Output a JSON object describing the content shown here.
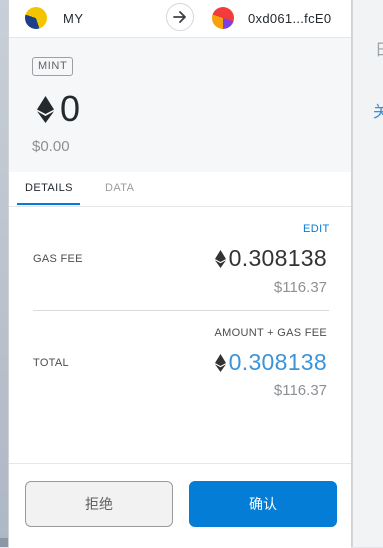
{
  "header": {
    "from_account_name": "MY",
    "to_account_address": "0xd061...fcE0"
  },
  "summary": {
    "action_badge": "MINT",
    "amount": "0",
    "fiat_amount": "$0.00"
  },
  "tabs": [
    {
      "label": "DETAILS",
      "active": true
    },
    {
      "label": "DATA",
      "active": false
    }
  ],
  "details": {
    "edit_label": "EDIT",
    "gas_fee_label": "GAS FEE",
    "gas_fee_eth": "0.308138",
    "gas_fee_fiat": "$116.37",
    "amount_gas_label": "AMOUNT + GAS FEE",
    "total_label": "TOTAL",
    "total_eth": "0.308138",
    "total_fiat": "$116.37"
  },
  "footer": {
    "reject_label": "拒绝",
    "confirm_label": "确认"
  },
  "background_fragments": {
    "frag1": "日",
    "frag2": "关"
  },
  "colors": {
    "accent": "#037dd6",
    "total_text": "#3b94d9"
  },
  "icons": {
    "currency": "ethereum-icon",
    "direction": "arrow-right-icon"
  }
}
